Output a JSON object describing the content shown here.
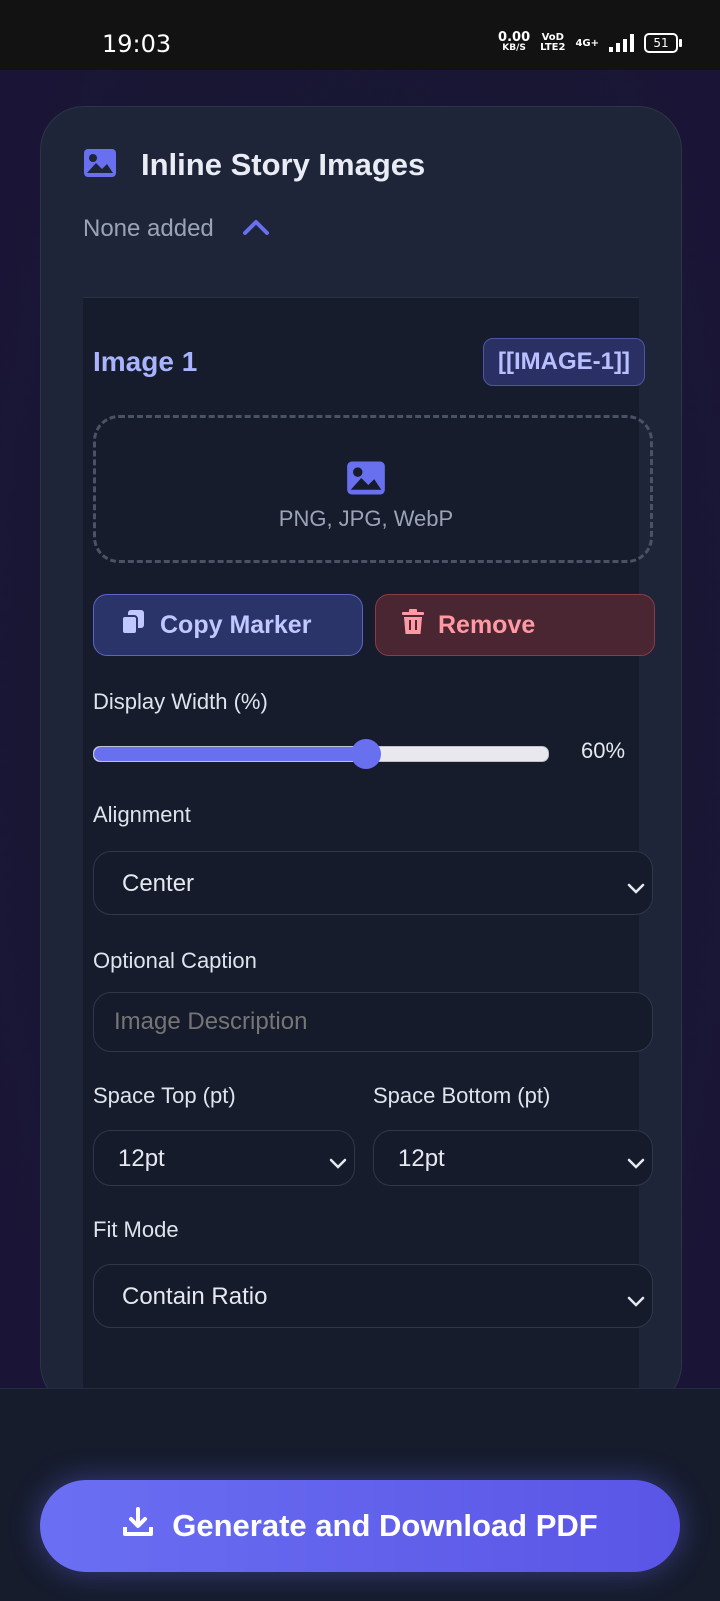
{
  "status_bar": {
    "time": "19:03",
    "net_speed_value": "0.00",
    "net_speed_unit": "KB/S",
    "volte_top": "VoD",
    "volte_bottom": "LTE2",
    "network": "4G+",
    "battery": "51"
  },
  "section": {
    "title": "Inline Story Images",
    "status": "None added",
    "icon": "image-icon",
    "toggle_icon": "chevron-up-icon"
  },
  "image_item": {
    "title": "Image 1",
    "marker": "[[IMAGE-1]]",
    "dropzone_types": "PNG, JPG, WebP",
    "copy_label": "Copy Marker",
    "remove_label": "Remove",
    "width_label": "Display Width (%)",
    "width_value": 60,
    "width_display": "60%",
    "alignment_label": "Alignment",
    "alignment_value": "Center",
    "caption_label": "Optional Caption",
    "caption_placeholder": "Image Description",
    "space_top_label": "Space Top (pt)",
    "space_top_value": "12pt",
    "space_bottom_label": "Space Bottom (pt)",
    "space_bottom_value": "12pt",
    "fit_label": "Fit Mode",
    "fit_value": "Contain Ratio"
  },
  "cta": {
    "label": "Generate and Download PDF",
    "icon": "download-icon"
  },
  "colors": {
    "accent": "#6870f0",
    "danger": "#ff9aa4",
    "card_bg": "#1e2538"
  }
}
